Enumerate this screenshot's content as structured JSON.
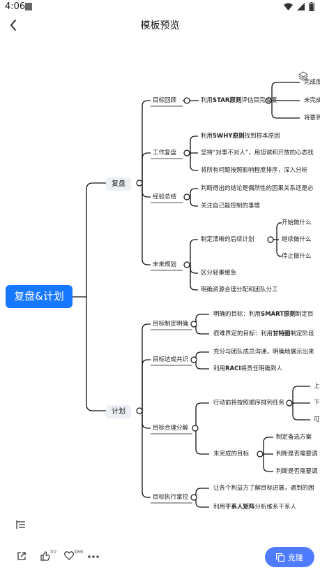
{
  "status_bar": {
    "time": "4:06"
  },
  "header": {
    "title": "模板预览",
    "back_icon": "arrow-left-icon"
  },
  "mindmap": {
    "root": "复盘&计划",
    "branch_review": "复盘",
    "branch_plan": "计划",
    "review": {
      "goal_review": "目标回顾",
      "star_prefix": "利用",
      "star_bold": "STAR原则",
      "star_suffix": "评估目完成度",
      "star_children": [
        "完成度",
        "未完成",
        "将要到"
      ],
      "work_review": "工作复盘",
      "work_items": [
        "利用",
        "5WHY原则",
        "找到根本原因"
      ],
      "work_item2": "坚持“对事不对人”，用坦诚和开放的心态找",
      "work_item3": "将所有问题按照影响程度排序，深入分析",
      "experience": "经验总结",
      "exp_item1": "判断得出的结论是偶然性的因果关系还是必",
      "exp_item2": "关注自己能控制的事情",
      "future": "未来规划",
      "future_plan": "制定清晰的后续计划",
      "future_plan_children": [
        "开始做什么",
        "继续做什么",
        "停止做什么"
      ],
      "future_item2": "区分轻重缓急",
      "future_item3": "明确资源合理分配和团队分工"
    },
    "plan": {
      "goal_clear": "目标制定明确",
      "clear_item1_prefix": "明确的目标：利用",
      "clear_item1_bold": "SMART原则",
      "clear_item1_suffix": "制定目",
      "clear_item2_prefix": "很难界定的目标：利用",
      "clear_item2_bold": "甘特图",
      "clear_item2_suffix": "制定阶段",
      "consensus": "目标达成共识",
      "cons_item1": "充分与团队成员沟通，明确地展示出来",
      "cons_item2_prefix": "利用",
      "cons_item2_bold": "RACI",
      "cons_item2_suffix": "将责任明确到人",
      "decompose": "目标合理分解",
      "dec_item1": "行动前将按照顺序排列任务",
      "dec_item1_children": [
        "上",
        "下",
        "可"
      ],
      "dec_item2": "未完成的目标",
      "dec_item2_children": [
        "制定备选方案",
        "判断是否需要调",
        "判断是否需要调"
      ],
      "control": "目标执行掌控",
      "ctrl_item1": "让各个利益方了解目标进展，遇到的困",
      "ctrl_item2_prefix": "利用",
      "ctrl_item2_bold": "干系人矩阵",
      "ctrl_item2_suffix": "分析维系干系人"
    }
  },
  "bottom_bar": {
    "like_count": "50",
    "favorite_count": "486",
    "clone_label": "克隆"
  },
  "colors": {
    "accent": "#1677ff",
    "clone": "#4f7cff",
    "pill": "#eceff3"
  }
}
